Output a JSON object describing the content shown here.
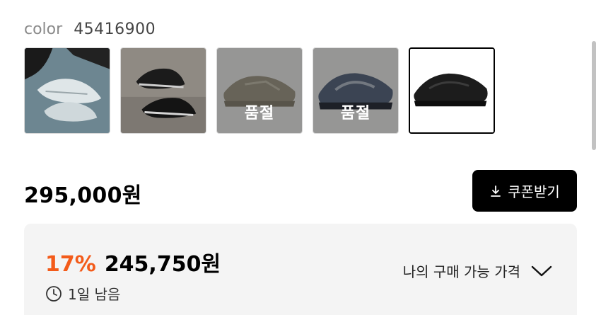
{
  "color": {
    "label": "color",
    "value": "45416900"
  },
  "thumbnails": [
    {
      "name": "thumb-1",
      "sold_out": false
    },
    {
      "name": "thumb-2",
      "sold_out": false
    },
    {
      "name": "thumb-3",
      "sold_out": true,
      "badge": "품절"
    },
    {
      "name": "thumb-4",
      "sold_out": true,
      "badge": "품절"
    },
    {
      "name": "thumb-5",
      "sold_out": false,
      "selected": true
    }
  ],
  "price": {
    "original": "295,000원"
  },
  "coupon_button": {
    "label": "쿠폰받기",
    "icon": "download-icon"
  },
  "discount_panel": {
    "rate": "17%",
    "sale_price": "245,750원",
    "remaining": "1일 남음",
    "my_price_label": "나의 구매 가능 가격",
    "accent": "#f35b1a"
  }
}
